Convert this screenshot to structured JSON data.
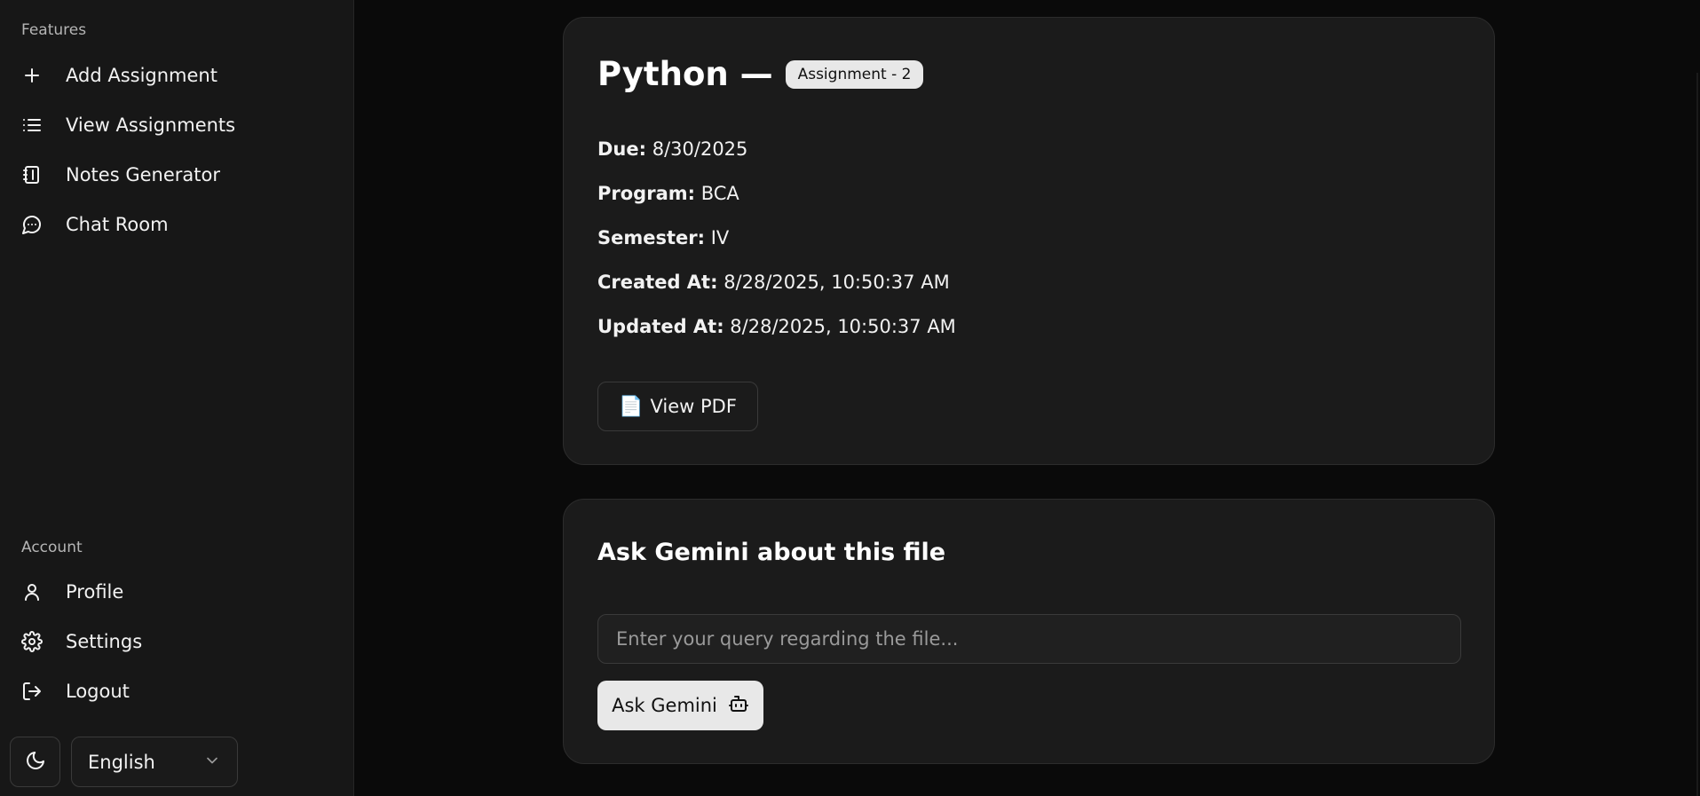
{
  "sidebar": {
    "features_title": "Features",
    "features": [
      {
        "label": "Add Assignment",
        "icon": "plus-icon"
      },
      {
        "label": "View Assignments",
        "icon": "list-icon"
      },
      {
        "label": "Notes Generator",
        "icon": "notebook-icon"
      },
      {
        "label": "Chat Room",
        "icon": "chat-icon"
      }
    ],
    "account_title": "Account",
    "account": [
      {
        "label": "Profile",
        "icon": "user-icon"
      },
      {
        "label": "Settings",
        "icon": "gear-icon"
      },
      {
        "label": "Logout",
        "icon": "logout-icon"
      }
    ],
    "theme_icon": "moon-icon",
    "language": "English"
  },
  "assignment": {
    "subject": "Python —",
    "badge": "Assignment - 2",
    "fields": [
      {
        "label": "Due:",
        "value": "8/30/2025"
      },
      {
        "label": "Program:",
        "value": "BCA"
      },
      {
        "label": "Semester:",
        "value": "IV"
      },
      {
        "label": "Created At:",
        "value": "8/28/2025, 10:50:37 AM"
      },
      {
        "label": "Updated At:",
        "value": "8/28/2025, 10:50:37 AM"
      }
    ],
    "view_pdf_label": "View PDF",
    "view_pdf_icon": "📄"
  },
  "gemini": {
    "title": "Ask Gemini about this file",
    "placeholder": "Enter your query regarding the file...",
    "value": "",
    "button_label": "Ask Gemini",
    "button_icon": "bot-icon"
  },
  "colors": {
    "background": "#0a0a0a",
    "sidebar": "#171717",
    "card": "#1b1b1b",
    "button_light": "#e8e8e8"
  }
}
